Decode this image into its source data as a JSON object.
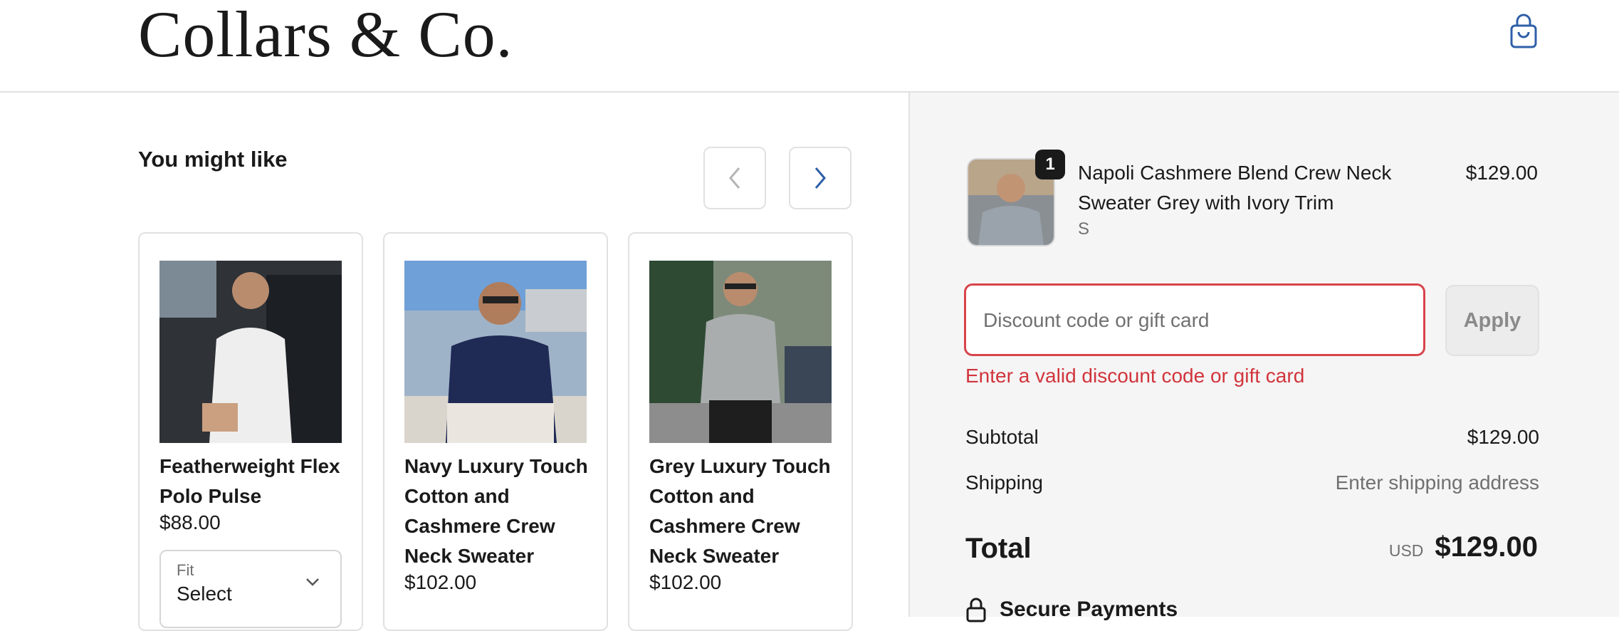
{
  "header": {
    "brand": "Collars & Co."
  },
  "recommendations": {
    "heading": "You might like",
    "products": [
      {
        "title": "Featherweight Flex Polo Pulse",
        "price": "$88.00",
        "fit_label": "Fit",
        "fit_value": "Select"
      },
      {
        "title": "Navy Luxury Touch Cotton and Cashmere Crew Neck Sweater",
        "price": "$102.00"
      },
      {
        "title": "Grey Luxury Touch Cotton and Cashmere Crew Neck Sweater",
        "price": "$102.00"
      }
    ]
  },
  "cart": {
    "item": {
      "name": "Napoli Cashmere Blend Crew Neck Sweater Grey with Ivory Trim",
      "variant": "S",
      "price": "$129.00",
      "quantity": "1"
    },
    "discount": {
      "placeholder": "Discount code or gift card",
      "apply_label": "Apply",
      "error": "Enter a valid discount code or gift card"
    },
    "summary": {
      "subtotal_label": "Subtotal",
      "subtotal_value": "$129.00",
      "shipping_label": "Shipping",
      "shipping_value": "Enter shipping address",
      "total_label": "Total",
      "currency": "USD",
      "total_value": "$129.00"
    },
    "secure_label": "Secure Payments"
  },
  "colors": {
    "accent": "#2f5fa8",
    "error": "#d1343c",
    "panel": "#f5f5f5"
  }
}
